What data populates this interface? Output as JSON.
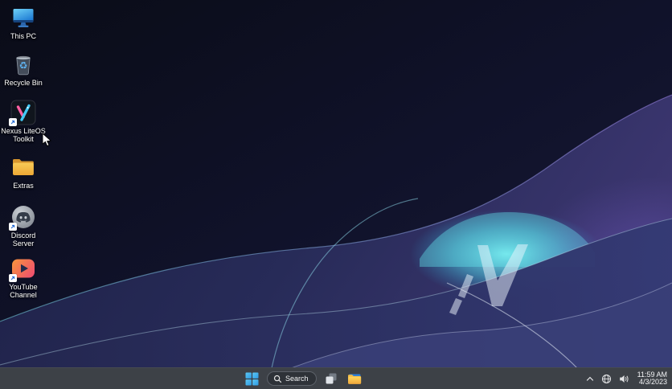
{
  "theme": {
    "taskbar_bg": "#3d4147",
    "taskbar_border": "rgba(255,255,255,0.05)",
    "search_pill_bg": "#2e3238",
    "search_pill_border": "#5c6169",
    "text_light": "#f3f4f6",
    "icon_label_color": "#ffffff",
    "accent_blue": "#42b0ea",
    "wallpaper_dark": "#0a0c17",
    "wallpaper_navy": "#10122a",
    "wallpaper_slate": "#272b58",
    "wallpaper_light_slate": "#343a74",
    "glow_cyan": "#63e6ee",
    "line_cyan": "#8fdcec",
    "line_purple": "#a98df5",
    "logo_fill": "rgba(238,246,253,0.5)"
  },
  "desktop": {
    "wallpaper_monogram": "/V",
    "icons": [
      {
        "label": "This PC",
        "icon": "this-pc-monitor-icon",
        "shortcut_overlay": false
      },
      {
        "label": "Recycle Bin",
        "icon": "recycle-bin-icon",
        "shortcut_overlay": false
      },
      {
        "label": "Nexus LiteOS Toolkit",
        "icon": "nexus-liteos-toolkit-icon",
        "shortcut_overlay": true
      },
      {
        "label": "Extras",
        "icon": "folder-icon",
        "shortcut_overlay": false
      },
      {
        "label": "Discord Server",
        "icon": "discord-icon",
        "shortcut_overlay": true
      },
      {
        "label": "YouTube Channel",
        "icon": "youtube-icon",
        "shortcut_overlay": true
      }
    ]
  },
  "taskbar": {
    "search_label": "Search",
    "buttons": [
      "start",
      "search",
      "task-view",
      "file-explorer"
    ],
    "tray": {
      "icons": [
        "hidden-icons-chevron",
        "network-globe",
        "volume"
      ],
      "time": "11:59 AM",
      "date": "4/3/2023"
    }
  }
}
